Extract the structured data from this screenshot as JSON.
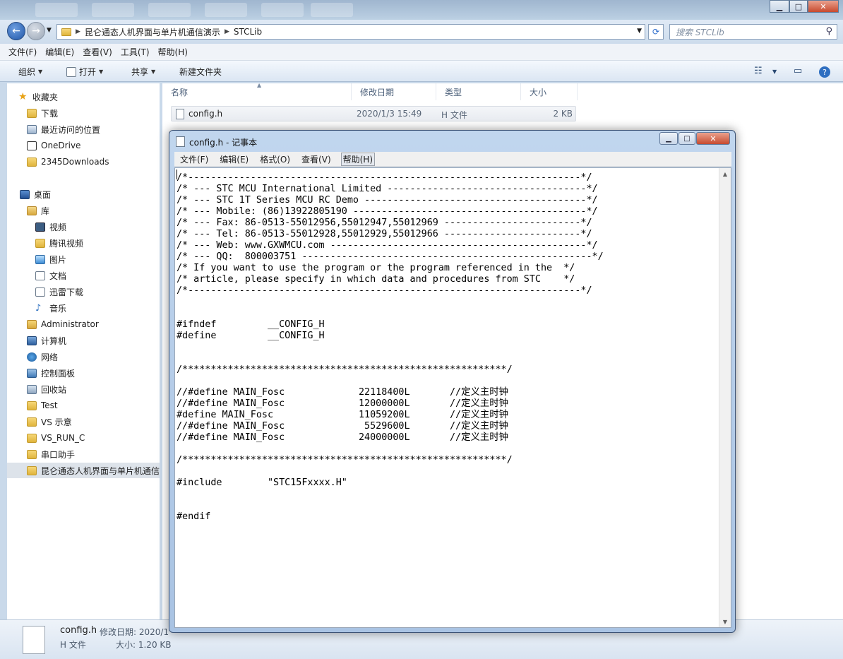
{
  "explorer": {
    "breadcrumb": [
      "昆仑通态人机界面与单片机通信演示",
      "STCLib"
    ],
    "search_placeholder": "搜索 STCLib",
    "menu": [
      "文件(F)",
      "编辑(E)",
      "查看(V)",
      "工具(T)",
      "帮助(H)"
    ],
    "toolbar": {
      "organize": "组织",
      "open": "打开",
      "share": "共享",
      "new_folder": "新建文件夹"
    },
    "columns": [
      "名称",
      "修改日期",
      "类型",
      "大小"
    ],
    "files": [
      {
        "name": "config.h",
        "modified": "2020/1/3 15:49",
        "type": "H 文件",
        "size": "2 KB"
      }
    ],
    "nav": [
      {
        "label": "收藏夹",
        "icon": "star-icon"
      },
      {
        "label": "下载",
        "icon": "folder-icon"
      },
      {
        "label": "最近访问的位置",
        "icon": "recent-places-icon"
      },
      {
        "label": "OneDrive",
        "icon": "cloud-icon"
      },
      {
        "label": "2345Downloads",
        "icon": "folder-icon"
      },
      {
        "label": "桌面",
        "icon": "desktop-icon"
      },
      {
        "label": "库",
        "icon": "library-icon"
      },
      {
        "label": "视频",
        "icon": "video-icon"
      },
      {
        "label": "腾讯视频",
        "icon": "folder-icon"
      },
      {
        "label": "图片",
        "icon": "picture-icon"
      },
      {
        "label": "文档",
        "icon": "document-icon"
      },
      {
        "label": "迅雷下载",
        "icon": "download-icon"
      },
      {
        "label": "音乐",
        "icon": "music-icon"
      },
      {
        "label": "Administrator",
        "icon": "user-folder-icon"
      },
      {
        "label": "计算机",
        "icon": "computer-icon"
      },
      {
        "label": "网络",
        "icon": "network-icon"
      },
      {
        "label": "控制面板",
        "icon": "control-panel-icon"
      },
      {
        "label": "回收站",
        "icon": "recycle-bin-icon"
      },
      {
        "label": "Test",
        "icon": "folder-icon"
      },
      {
        "label": "VS 示意",
        "icon": "folder-icon"
      },
      {
        "label": "VS_RUN_C",
        "icon": "folder-icon"
      },
      {
        "label": "串口助手",
        "icon": "folder-icon"
      },
      {
        "label": "昆仑通态人机界面与单片机通信",
        "icon": "folder-icon"
      }
    ],
    "details": {
      "name": "config.h",
      "modified_label": "修改日期: 2020/1",
      "type": "H 文件",
      "size_label": "大小: 1.20 KB"
    }
  },
  "notepad": {
    "title": "config.h - 记事本",
    "menu": [
      "文件(F)",
      "编辑(E)",
      "格式(O)",
      "查看(V)",
      "帮助(H)"
    ],
    "content": "/*---------------------------------------------------------------------*/\n/* --- STC MCU International Limited -----------------------------------*/\n/* --- STC 1T Series MCU RC Demo ---------------------------------------*/\n/* --- Mobile: (86)13922805190 -----------------------------------------*/\n/* --- Fax: 86-0513-55012956,55012947,55012969 ------------------------*/\n/* --- Tel: 86-0513-55012928,55012929,55012966 ------------------------*/\n/* --- Web: www.GXWMCU.com ---------------------------------------------*/\n/* --- QQ:  800003751 ---------------------------------------------------*/\n/* If you want to use the program or the program referenced in the  */\n/* article, please specify in which data and procedures from STC    */\n/*---------------------------------------------------------------------*/\n\n\n#ifndef         __CONFIG_H\n#define         __CONFIG_H\n\n\n/*********************************************************/\n\n//#define MAIN_Fosc             22118400L       //定义主时钟\n//#define MAIN_Fosc             12000000L       //定义主时钟\n#define MAIN_Fosc               11059200L       //定义主时钟\n//#define MAIN_Fosc              5529600L       //定义主时钟\n//#define MAIN_Fosc             24000000L       //定义主时钟\n\n/*********************************************************/\n\n#include        \"STC15Fxxxx.H\"\n\n\n#endif"
  }
}
